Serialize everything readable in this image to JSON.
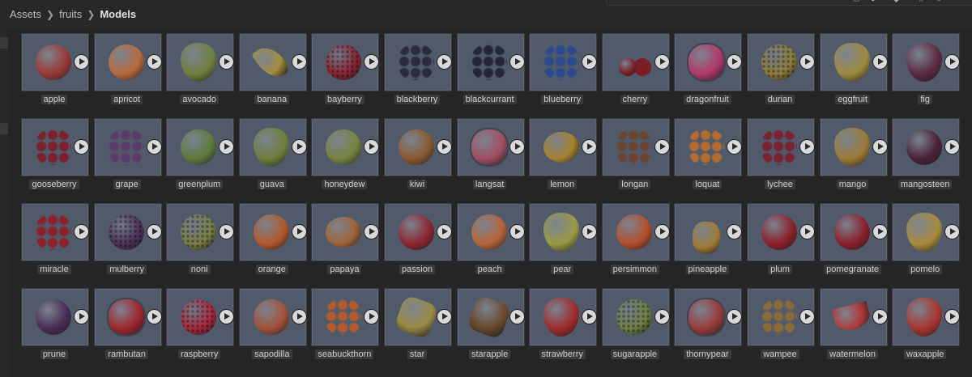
{
  "breadcrumb": [
    "Assets",
    "fruits",
    "Models"
  ],
  "fruits": [
    {
      "name": "apple",
      "color": "#9b3a33",
      "shape": "round"
    },
    {
      "name": "apricot",
      "color": "#b86a3c",
      "shape": "round"
    },
    {
      "name": "avocado",
      "color": "#6f7f3e",
      "shape": "pear"
    },
    {
      "name": "banana",
      "color": "#a58d3c",
      "shape": "banana"
    },
    {
      "name": "bayberry",
      "color": "#8a2432",
      "shape": "bumpy"
    },
    {
      "name": "blackberry",
      "color": "#2a2b3d",
      "shape": "cluster"
    },
    {
      "name": "blackcurrant",
      "color": "#242638",
      "shape": "cluster"
    },
    {
      "name": "blueberry",
      "color": "#2c4a8c",
      "shape": "cluster"
    },
    {
      "name": "cherry",
      "color": "#7a1d24",
      "shape": "cherry"
    },
    {
      "name": "dragonfruit",
      "color": "#b23a6a",
      "shape": "spiky"
    },
    {
      "name": "durian",
      "color": "#8f7d3c",
      "shape": "bumpy"
    },
    {
      "name": "eggfruit",
      "color": "#9e8a3c",
      "shape": "pear"
    },
    {
      "name": "fig",
      "color": "#5b2a3f",
      "shape": "pear"
    },
    {
      "name": "gooseberry",
      "color": "#7b1f2c",
      "shape": "cluster"
    },
    {
      "name": "grape",
      "color": "#5c3a6a",
      "shape": "cluster"
    },
    {
      "name": "greenplum",
      "color": "#5f7a3c",
      "shape": "round"
    },
    {
      "name": "guava",
      "color": "#6d7e3a",
      "shape": "pear"
    },
    {
      "name": "honeydew",
      "color": "#778540",
      "shape": "round"
    },
    {
      "name": "kiwi",
      "color": "#8a5a30",
      "shape": "round"
    },
    {
      "name": "langsat",
      "color": "#a24e62",
      "shape": "spiky"
    },
    {
      "name": "lemon",
      "color": "#a5822e",
      "shape": "oval"
    },
    {
      "name": "longan",
      "color": "#6a4531",
      "shape": "cluster"
    },
    {
      "name": "loquat",
      "color": "#b46a30",
      "shape": "cluster"
    },
    {
      "name": "lychee",
      "color": "#7a2230",
      "shape": "cluster"
    },
    {
      "name": "mango",
      "color": "#9c7a35",
      "shape": "pear"
    },
    {
      "name": "mangosteen",
      "color": "#4a2235",
      "shape": "round"
    },
    {
      "name": "miracle",
      "color": "#8c2228",
      "shape": "cluster"
    },
    {
      "name": "mulberry",
      "color": "#4e3359",
      "shape": "bumpy"
    },
    {
      "name": "noni",
      "color": "#7a7f45",
      "shape": "bumpy"
    },
    {
      "name": "orange",
      "color": "#b0592c",
      "shape": "round"
    },
    {
      "name": "papaya",
      "color": "#a0643a",
      "shape": "oval"
    },
    {
      "name": "passion",
      "color": "#8c2730",
      "shape": "round"
    },
    {
      "name": "peach",
      "color": "#b5643c",
      "shape": "round"
    },
    {
      "name": "pear",
      "color": "#9a9a45",
      "shape": "pear"
    },
    {
      "name": "persimmon",
      "color": "#b44e2c",
      "shape": "round"
    },
    {
      "name": "pineapple",
      "color": "#a07a34",
      "shape": "pineapple"
    },
    {
      "name": "plum",
      "color": "#8c202a",
      "shape": "round"
    },
    {
      "name": "pomegranate",
      "color": "#8a1f2c",
      "shape": "round"
    },
    {
      "name": "pomelo",
      "color": "#a88a3c",
      "shape": "pear"
    },
    {
      "name": "prune",
      "color": "#4a2b54",
      "shape": "round"
    },
    {
      "name": "rambutan",
      "color": "#a0262e",
      "shape": "spiky"
    },
    {
      "name": "raspberry",
      "color": "#a8283c",
      "shape": "bumpy"
    },
    {
      "name": "sapodilla",
      "color": "#a3503a",
      "shape": "round"
    },
    {
      "name": "seabuckthorn",
      "color": "#b45a2c",
      "shape": "cluster"
    },
    {
      "name": "star",
      "color": "#9a8a44",
      "shape": "star"
    },
    {
      "name": "starapple",
      "color": "#6a4a2e",
      "shape": "star"
    },
    {
      "name": "strawberry",
      "color": "#a02a2c",
      "shape": "pear"
    },
    {
      "name": "sugarapple",
      "color": "#6f8046",
      "shape": "bumpy"
    },
    {
      "name": "thornypear",
      "color": "#9a3a3a",
      "shape": "spiky"
    },
    {
      "name": "wampee",
      "color": "#8a6a38",
      "shape": "cluster"
    },
    {
      "name": "watermelon",
      "color": "#b03a3a",
      "shape": "wedge"
    },
    {
      "name": "waxapple",
      "color": "#a8342e",
      "shape": "pear"
    }
  ]
}
